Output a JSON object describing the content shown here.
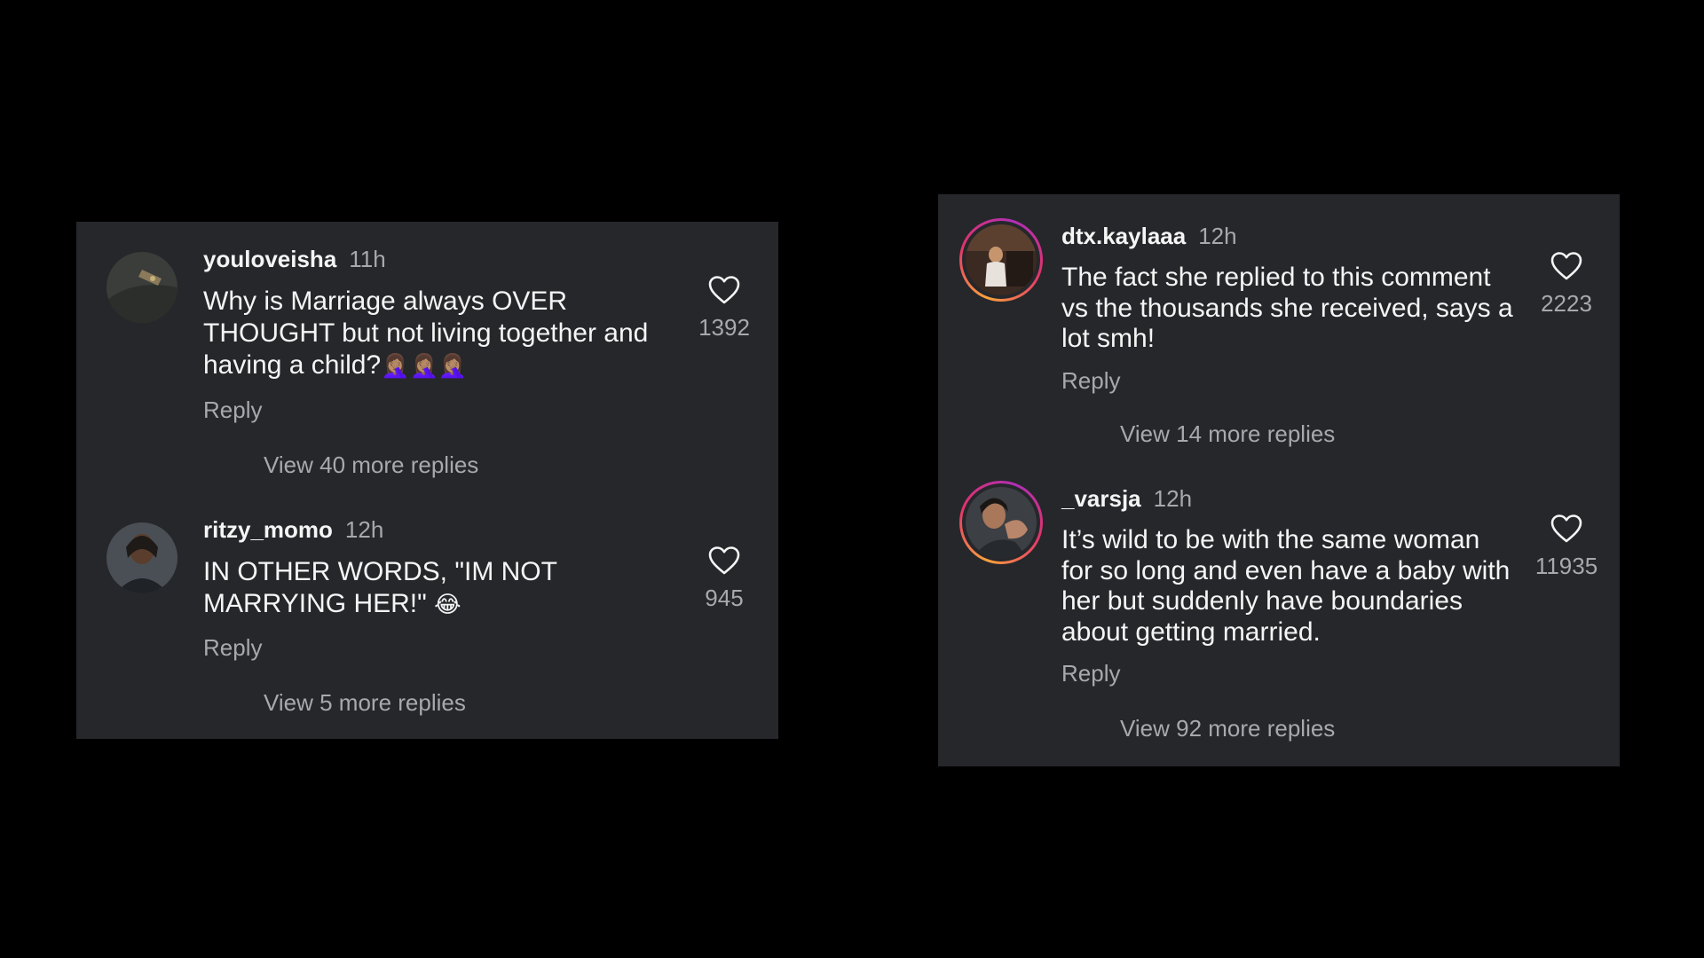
{
  "left_panel": {
    "comments": [
      {
        "username": "youloveisha",
        "time": "11h",
        "text_lines": [
          "Why is Marriage always OVER",
          "THOUGHT but not living together and",
          "having a child?"
        ],
        "emoji": "🤦🏽‍♀️🤦🏽‍♀️🤦🏽‍♀️",
        "reply_label": "Reply",
        "likes": "1392",
        "view_replies_label": "View 40 more replies",
        "avatar_icon": "avatar-photo"
      },
      {
        "username": "ritzy_momo",
        "time": "12h",
        "text_lines": [
          "IN OTHER WORDS, \"IM NOT",
          "MARRYING HER!\""
        ],
        "emoji": "😂",
        "reply_label": "Reply",
        "likes": "945",
        "view_replies_label": "View 5 more replies",
        "avatar_icon": "avatar-photo"
      }
    ]
  },
  "right_panel": {
    "comments": [
      {
        "username": "dtx.kaylaaa",
        "time": "12h",
        "text_lines": [
          "The fact she replied to this comment",
          "vs the thousands she received, says a",
          "lot smh!"
        ],
        "reply_label": "Reply",
        "likes": "2223",
        "view_replies_label": "View 14 more replies",
        "avatar_icon": "story-ring-avatar"
      },
      {
        "username": "_varsja",
        "time": "12h",
        "text_lines": [
          "It’s wild to be with the same woman",
          "for so long and even have a baby with",
          "her but suddenly have boundaries",
          "about getting married."
        ],
        "reply_label": "Reply",
        "likes": "11935",
        "view_replies_label": "View 92 more replies",
        "avatar_icon": "story-ring-avatar"
      }
    ]
  },
  "colors": {
    "page_background": "#000000",
    "panel_background": "#26272b",
    "primary_text": "#f5f5f5",
    "secondary_text": "#a8a8ad",
    "story_ring": [
      "#f9a23c",
      "#e2336b",
      "#b12fb7"
    ]
  },
  "icons": {
    "like": "heart-outline-icon"
  }
}
